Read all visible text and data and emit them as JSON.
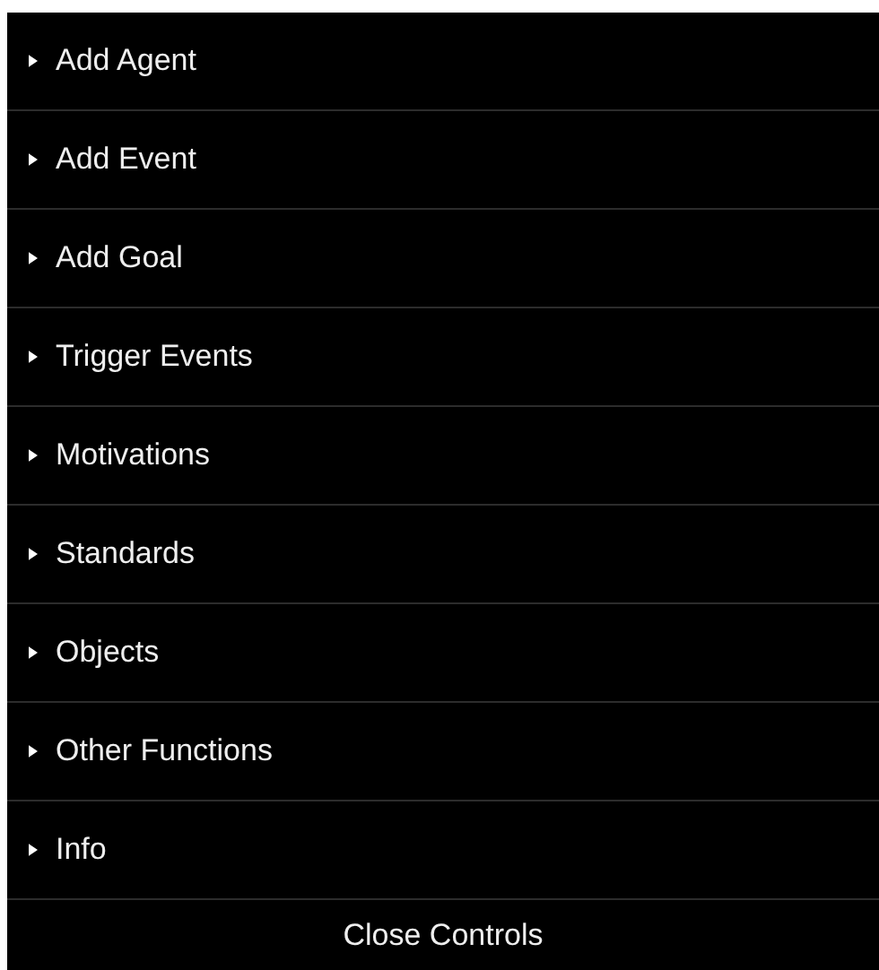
{
  "folders": [
    {
      "label": "Add Agent",
      "expanded": false
    },
    {
      "label": "Add Event",
      "expanded": false
    },
    {
      "label": "Add Goal",
      "expanded": false
    },
    {
      "label": "Trigger Events",
      "expanded": false
    },
    {
      "label": "Motivations",
      "expanded": false
    },
    {
      "label": "Standards",
      "expanded": false
    },
    {
      "label": "Objects",
      "expanded": false
    },
    {
      "label": "Other Functions",
      "expanded": false
    },
    {
      "label": "Info",
      "expanded": false
    }
  ],
  "close_button": "Close Controls"
}
